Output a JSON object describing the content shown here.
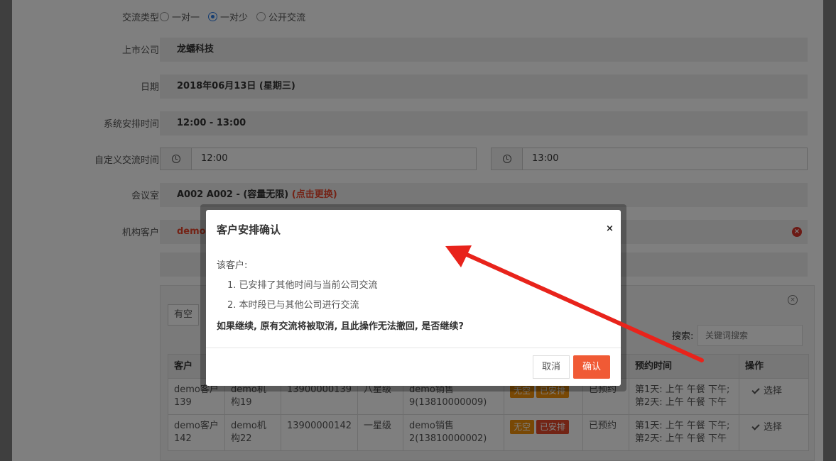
{
  "form": {
    "type_label": "交流类型",
    "type_options": [
      "一对一",
      "一对少",
      "公开交流"
    ],
    "company_label": "上市公司",
    "company_value": "龙蟠科技",
    "date_label": "日期",
    "date_value": "2018年06月13日 (星期三)",
    "sys_time_label": "系统安排时间",
    "sys_time_value": "12:00 - 13:00",
    "custom_time_label": "自定义交流时间",
    "start_time": "12:00",
    "end_time": "13:00",
    "room_label": "会议室",
    "room_value": "A002 A002 - (容量无限)",
    "room_change": "(点击更换)",
    "client_label": "机构客户",
    "client_value": "demo客"
  },
  "panel": {
    "filter_btn": "有空",
    "search_label": "搜索:",
    "search_placeholder": "关键词搜索",
    "headers": [
      "客户",
      "",
      "",
      "",
      "",
      "",
      "",
      "预约时间",
      "操作"
    ],
    "rows": [
      {
        "c1": "demo客户139",
        "c2": "demo机构19",
        "c3": "13900000139",
        "c4": "八星级",
        "c5": "demo销售9(13810000009)",
        "b1": "无空",
        "b2": "已安排",
        "c7": "已预约",
        "t1": "第1天: 上午 午餐 下午;",
        "t2": "第2天: 上午 午餐 下午",
        "op": "选择"
      },
      {
        "c1": "demo客户142",
        "c2": "demo机构22",
        "c3": "13900000142",
        "c4": "一星级",
        "c5": "demo销售2(13810000002)",
        "b1": "无空",
        "b2": "已安排",
        "c7": "已预约",
        "t1": "第1天: 上午 午餐 下午;",
        "t2": "第2天: 上午 午餐 下午",
        "op": "选择"
      }
    ]
  },
  "modal": {
    "title": "客户安排确认",
    "close": "×",
    "intro": "该客户:",
    "item1": "1. 已安排了其他时间与当前公司交流",
    "item2": "2. 本时段已与其他公司进行交流",
    "question": "如果继续, 原有交流将被取消, 且此操作无法撤回, 是否继续?",
    "cancel": "取消",
    "confirm": "确认"
  },
  "colors": {
    "accent_red": "#e8462c",
    "confirm_btn": "#f05a35",
    "arrow": "#e8231b"
  }
}
